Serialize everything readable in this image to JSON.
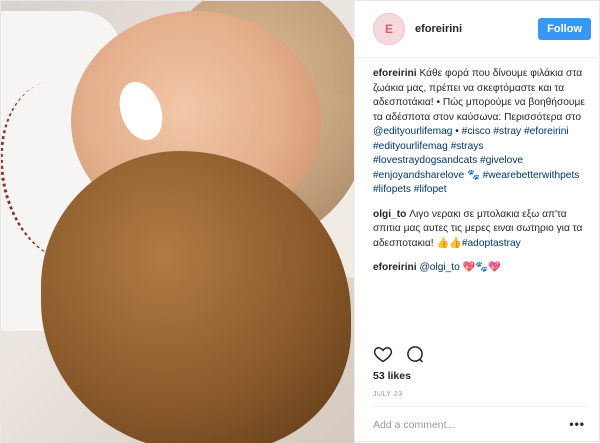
{
  "header": {
    "avatar_text": "E",
    "username": "eforeirini",
    "follow_label": "Follow"
  },
  "caption": {
    "user": "eforeirini",
    "text": "Κάθε φορά που δίνουμε φιλάκια στα ζωάκια μας, πρέπει να σκεφτόμαστε και τα αδεσποτάκια! • Πώς μπορούμε να βοηθήσουμε τα αδέσποτα στον καύσωνα: Περισσότερα στο ",
    "mention": "@edityourlifemag",
    "bullet": " • ",
    "hashtags": "#cisco #stray #eforeirini #edityourlifemag #strays #lovestraydogsandcats #givelove #enjoyandsharelove",
    "emoji1": " 🐾 ",
    "hashtags2": "#wearebetterwithpets #lifopets #lifopet"
  },
  "comment1": {
    "user": "olgi_to",
    "text": " Λιγο νερακι σε μπολακια εξω απ'τα σπιτια μας αυτες τις μερες ειναι σωτηριο για τα αδεσποτακια! 👍👍",
    "hashtag": "#adoptastray"
  },
  "comment2": {
    "user": "eforeirini",
    "mention": "@olgi_to",
    "emojis": " 💖🐾💖"
  },
  "likes": "53 likes",
  "date": "JULY 23",
  "add_comment_placeholder": "Add a comment...",
  "more_label": "•••",
  "colors": {
    "follow_bg": "#3897f0",
    "link": "#003569"
  }
}
